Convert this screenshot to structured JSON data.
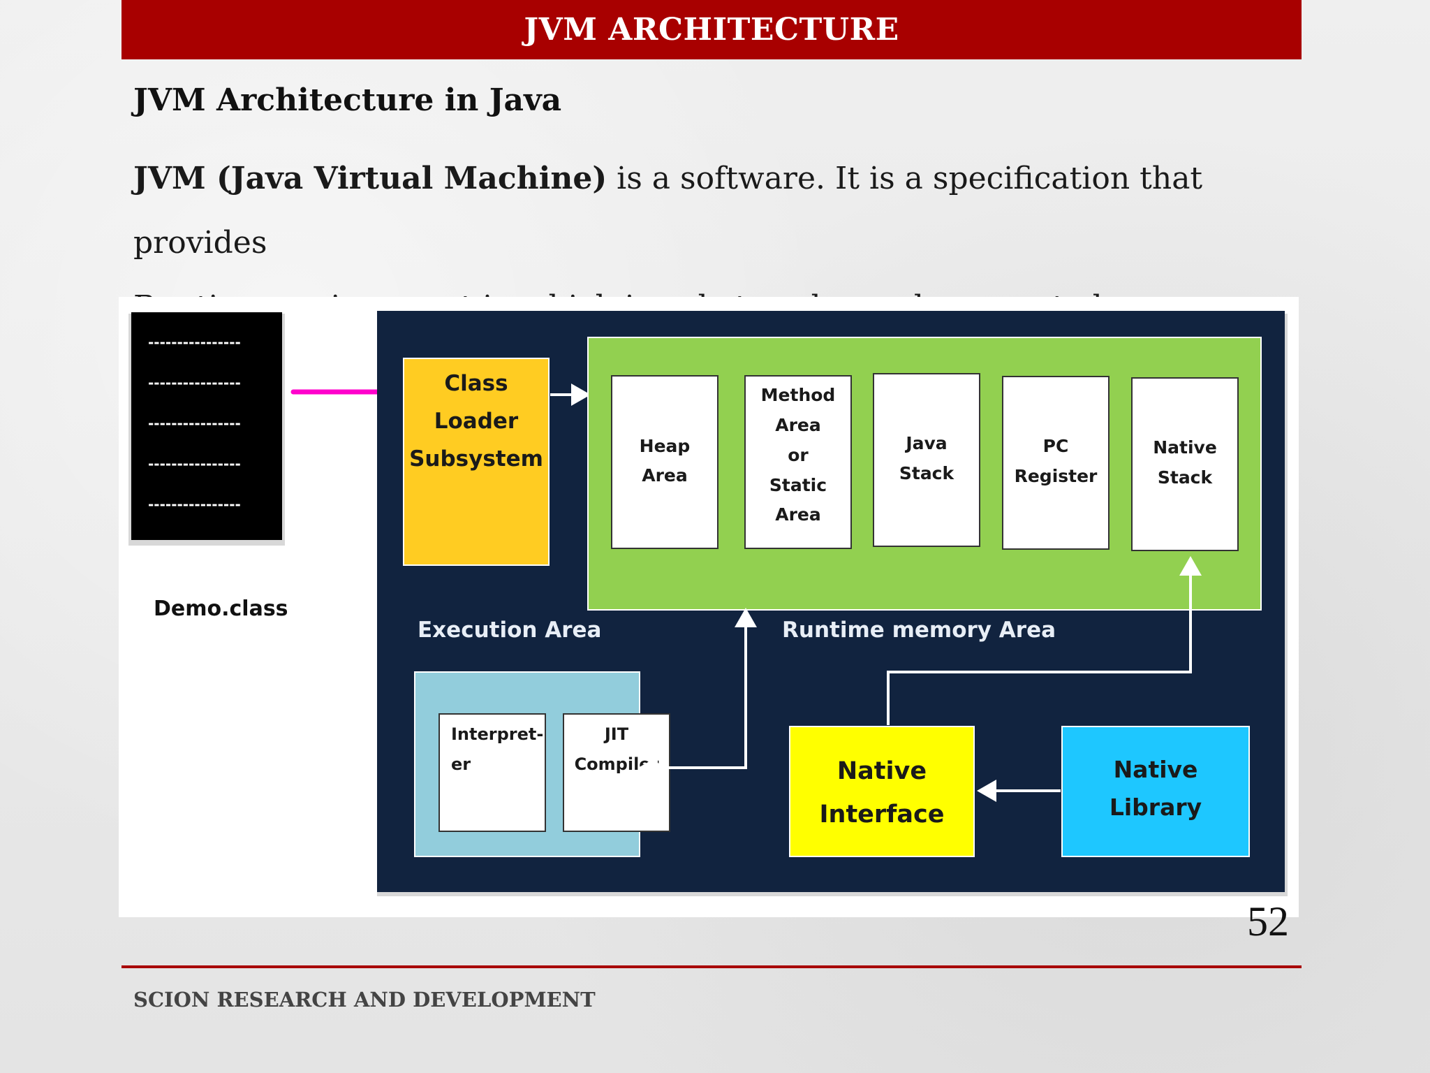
{
  "slide": {
    "title": "JVM ARCHITECTURE",
    "heading": "JVM Architecture in Java",
    "paragraph_bold": "JVM (Java Virtual Machine)",
    "paragraph_rest": " is a software. It is a specification that provides",
    "paragraph_line2": "Runtime environment in which java bytecode can be executed.",
    "page_number": "52",
    "footer": "SCION RESEARCH AND DEVELOPMENT"
  },
  "diagram": {
    "class_file_label": "Demo.class",
    "class_file_line": "----------------",
    "class_loader": [
      "Class",
      "Loader",
      "Subsystem"
    ],
    "execution_area_label": "Execution Area",
    "runtime_memory_label": "Runtime memory Area",
    "memory_areas": {
      "heap": [
        "Heap",
        "Area"
      ],
      "method": [
        "Method",
        "Area",
        "or",
        "Static",
        "Area"
      ],
      "java_stack": [
        "Java",
        "Stack"
      ],
      "pc_register": [
        "PC",
        "Register"
      ],
      "native_stack": [
        "Native",
        "Stack"
      ]
    },
    "interpreter": [
      "Interpret-",
      "er"
    ],
    "jit": [
      "JIT",
      "Compiler"
    ],
    "native_interface": [
      "Native",
      "Interface"
    ],
    "native_library": [
      "Native",
      "Library"
    ],
    "colors": {
      "title_bar": "#a80000",
      "panel": "#11233f",
      "runtime": "#92d050",
      "class_loader": "#ffcc22",
      "execution": "#92cddc",
      "native_interface": "#ffff00",
      "native_library": "#1ec7ff",
      "arrow_magenta": "#ff00cc"
    }
  }
}
